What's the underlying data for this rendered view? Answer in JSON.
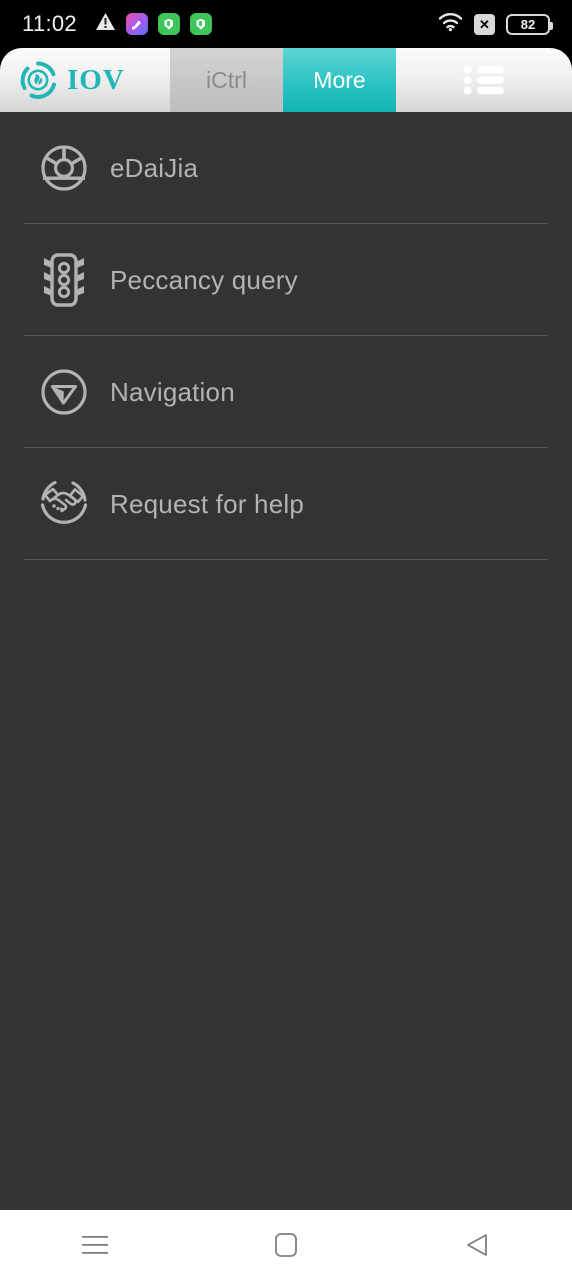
{
  "status_bar": {
    "time": "11:02",
    "left_icons": [
      {
        "name": "warning-triangle-icon"
      },
      {
        "name": "app-badge-gradient-icon"
      },
      {
        "name": "app-badge-shield-green-icon"
      },
      {
        "name": "app-badge-shield-green-2-icon"
      }
    ],
    "right_icons": [
      {
        "name": "wifi-icon"
      },
      {
        "name": "no-sim-x-icon",
        "label": "✕"
      }
    ],
    "battery_level": "82"
  },
  "header": {
    "brand_name": "IOV",
    "brand_logo_icon": "iov-swirl-logo-icon",
    "brand_color": "#23b6b6",
    "tabs": [
      {
        "label": "iCtrl",
        "active": false
      },
      {
        "label": "More",
        "active": true
      }
    ],
    "menu_button_icon": "list-menu-icon"
  },
  "main": {
    "items": [
      {
        "label": "eDaiJia",
        "icon": "steering-wheel-icon"
      },
      {
        "label": "Peccancy query",
        "icon": "traffic-light-icon"
      },
      {
        "label": "Navigation",
        "icon": "navigation-arrow-icon"
      },
      {
        "label": "Request for help",
        "icon": "handshake-icon"
      }
    ]
  },
  "navbar": {
    "buttons": [
      {
        "name": "recents-button",
        "icon": "hamburger-icon"
      },
      {
        "name": "home-button",
        "icon": "square-icon"
      },
      {
        "name": "back-button",
        "icon": "triangle-left-icon"
      }
    ]
  },
  "colors": {
    "accent": "#2cc3c3",
    "content_bg": "#333333",
    "text_muted": "#b3b3b3",
    "divider": "#555555"
  }
}
